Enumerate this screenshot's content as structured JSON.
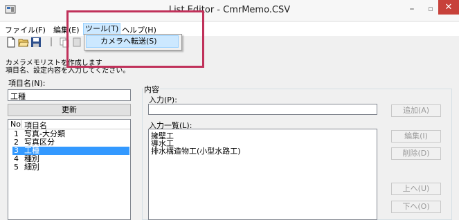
{
  "window": {
    "title": "List Editor - CmrMemo.CSV",
    "minimize_glyph": "–",
    "maximize_glyph": "▫",
    "close_glyph": "✕"
  },
  "menu": {
    "items": [
      "ファイル(F)",
      "編集(E)",
      "ツール(T)",
      "ヘルプ(H)"
    ],
    "dropdown_item": "カメラへ転送(S)"
  },
  "description": {
    "line1": "カメラメモリストを作成します",
    "line2": "項目名、設定内容を入力してください。"
  },
  "item_name": {
    "label": "項目名(N):",
    "value": "工種",
    "update_button": "更新"
  },
  "item_list": {
    "header_no": "No",
    "header_name": "項目名",
    "rows": [
      {
        "no": "1",
        "name": "写真-大分類"
      },
      {
        "no": "2",
        "name": "写真区分"
      },
      {
        "no": "3",
        "name": "工種"
      },
      {
        "no": "4",
        "name": "種別"
      },
      {
        "no": "5",
        "name": "細別"
      }
    ],
    "selected_index": 2
  },
  "content": {
    "group_label": "内容",
    "input_label": "入力(P):",
    "input_value": "",
    "add_button": "追加(A)",
    "list_label": "入力一覧(L):",
    "list_items": [
      "擁壁工",
      "導水工",
      "排水構造物工(小型水路工)"
    ],
    "edit_button": "編集(I)",
    "delete_button": "削除(D)",
    "up_button": "上へ(U)",
    "down_button": "下へ(O)"
  },
  "colors": {
    "highlight_border": "#c0315a",
    "selection": "#3399ff",
    "close_button": "#c7413a",
    "menu_hover": "#cce8ff"
  }
}
